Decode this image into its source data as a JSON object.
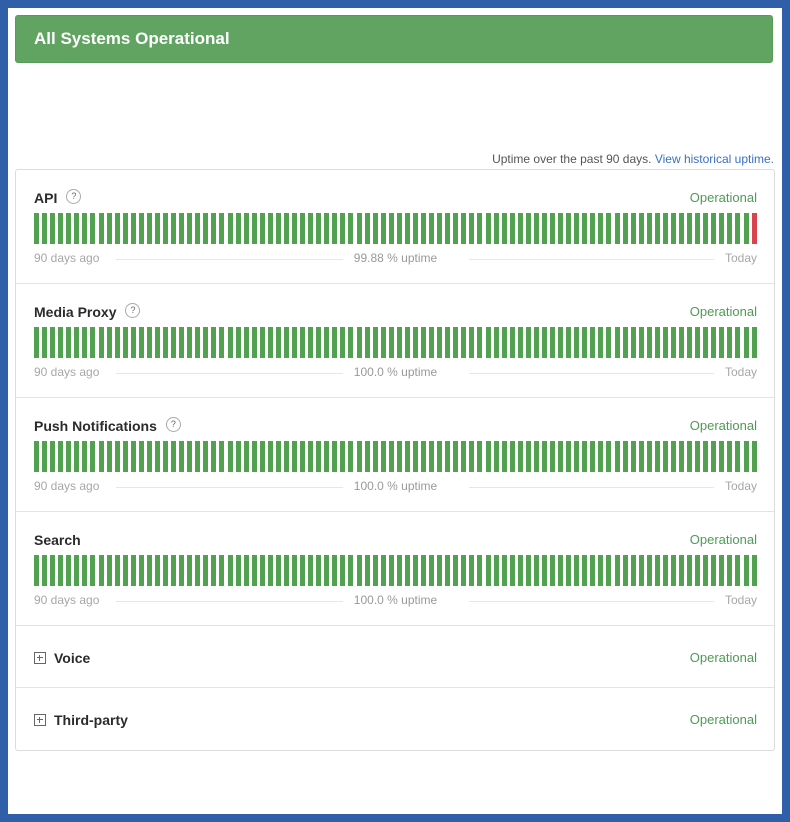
{
  "banner": {
    "title": "All Systems Operational"
  },
  "uptime_note": {
    "text": "Uptime over the past 90 days.",
    "link": "View historical uptime."
  },
  "colors": {
    "operational": "#52a150",
    "outage": "#d9434e",
    "banner": "#61a462"
  },
  "components": [
    {
      "name": "API",
      "help": "?",
      "status": "Operational",
      "days": 90,
      "outage_days": [
        89
      ],
      "start_label": "90 days ago",
      "uptime_label": "99.88 % uptime",
      "end_label": "Today"
    },
    {
      "name": "Media Proxy",
      "help": "?",
      "status": "Operational",
      "days": 90,
      "outage_days": [],
      "start_label": "90 days ago",
      "uptime_label": "100.0 % uptime",
      "end_label": "Today"
    },
    {
      "name": "Push Notifications",
      "help": "?",
      "status": "Operational",
      "days": 90,
      "outage_days": [],
      "start_label": "90 days ago",
      "uptime_label": "100.0 % uptime",
      "end_label": "Today"
    },
    {
      "name": "Search",
      "help": "",
      "status": "Operational",
      "days": 90,
      "outage_days": [],
      "start_label": "90 days ago",
      "uptime_label": "100.0 % uptime",
      "end_label": "Today"
    }
  ],
  "groups": [
    {
      "name": "Voice",
      "status": "Operational"
    },
    {
      "name": "Third-party",
      "status": "Operational"
    }
  ]
}
